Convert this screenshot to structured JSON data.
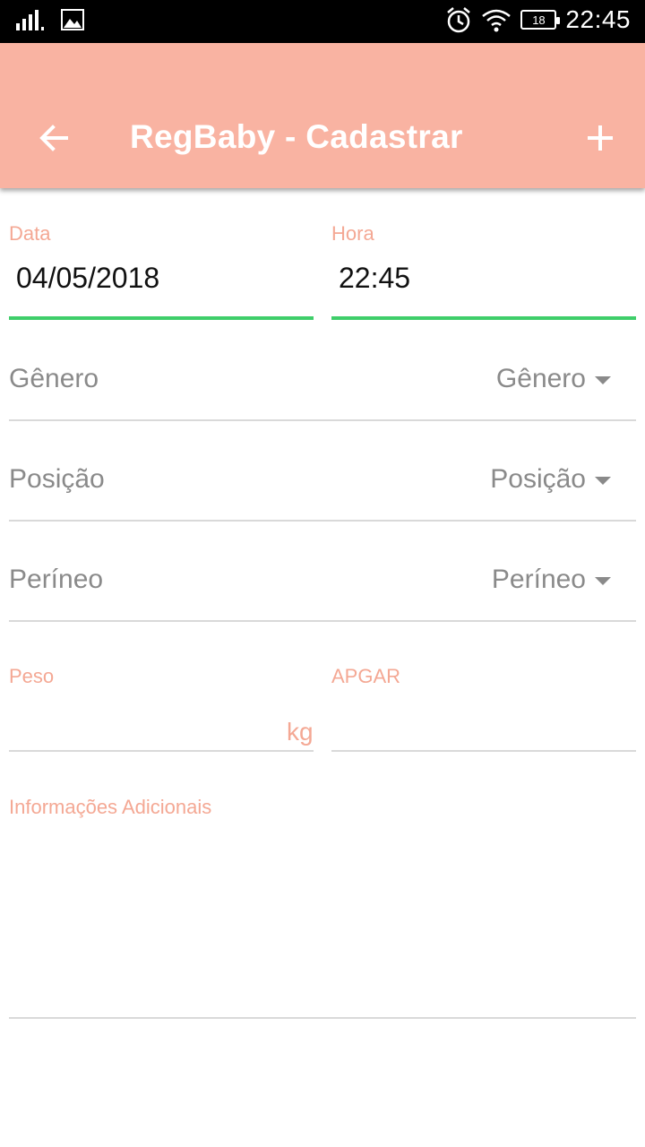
{
  "status_bar": {
    "time": "22:45",
    "battery": "18",
    "icons": [
      "signal-icon",
      "image-icon",
      "alarm-icon",
      "wifi-icon",
      "battery-icon"
    ]
  },
  "app_bar": {
    "title": "RegBaby - Cadastrar",
    "back_icon": "arrow-back-icon",
    "add_icon": "plus-icon",
    "color": "#f9b3a2"
  },
  "form": {
    "data": {
      "label": "Data",
      "value": "04/05/2018"
    },
    "hora": {
      "label": "Hora",
      "value": "22:45"
    },
    "genero": {
      "label": "Gênero",
      "selected": "Gênero"
    },
    "posicao": {
      "label": "Posição",
      "selected": "Posição"
    },
    "perineo": {
      "label": "Períneo",
      "selected": "Períneo"
    },
    "peso": {
      "label": "Peso",
      "value": "",
      "unit": "kg"
    },
    "apgar": {
      "label": "APGAR",
      "value": ""
    },
    "info": {
      "label": "Informações Adicionais",
      "value": ""
    }
  },
  "colors": {
    "accent": "#f4a894",
    "active_underline": "#3fce6a",
    "muted_text": "#8a8a8a"
  }
}
